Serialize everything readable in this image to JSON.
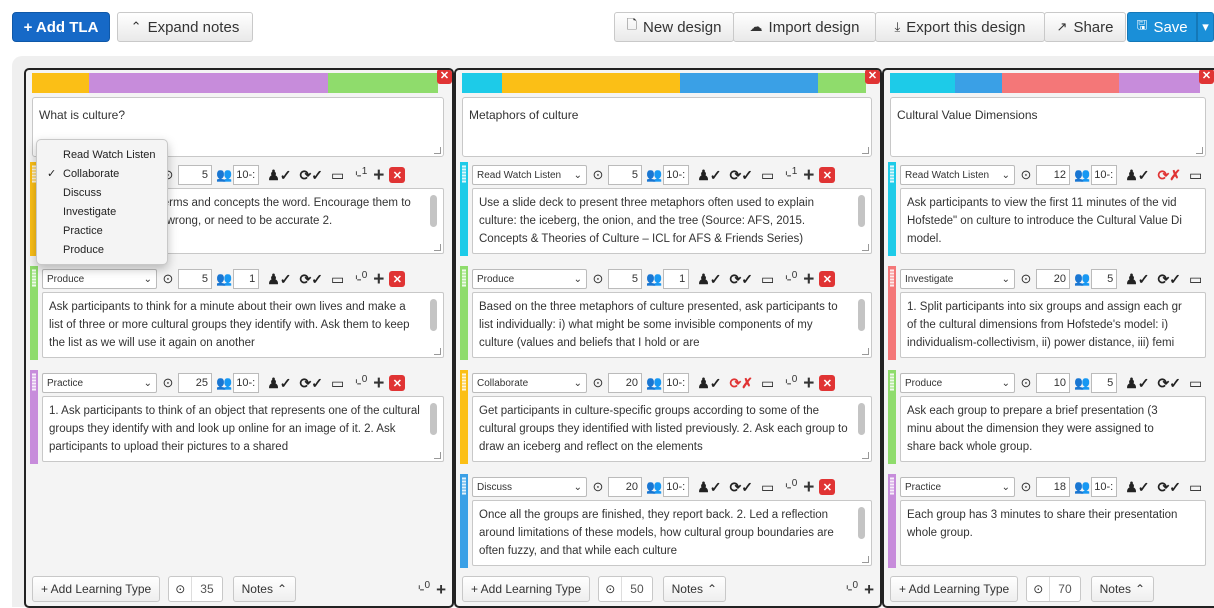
{
  "toolbar": {
    "add_tla": "+ Add TLA",
    "expand_notes": "Expand notes",
    "new_design": "New design",
    "import_design": "Import design",
    "export_design": "Export this design",
    "share": "Share",
    "save": "Save"
  },
  "menu": {
    "items": [
      "Read Watch Listen",
      "Collaborate",
      "Discuss",
      "Investigate",
      "Practice",
      "Produce"
    ],
    "checked": "Collaborate"
  },
  "designs": [
    {
      "title": "What is culture?",
      "colors": [
        "#fbbf16",
        "#c78cdb",
        "#8fdc6c"
      ],
      "tlas": [
        {
          "type": "Collaborate",
          "color": "#fbbf16",
          "duration": "5",
          "group": "10-:",
          "group_red": true,
          "assess_red": false,
          "attachments": "1",
          "text": "ask participants what terms and concepts the word. Encourage them to add as many o right or wrong, or need to be accurate 2."
        },
        {
          "type": "Produce",
          "color": "#8fdc6c",
          "duration": "5",
          "group": "1",
          "group_red": false,
          "assess_red": false,
          "attachments": "0",
          "text": "Ask participants to think for a minute about their own lives and make a list of three or more cultural groups they identify with. Ask them to keep the list as we will use it again on another"
        },
        {
          "type": "Practice",
          "color": "#c78cdb",
          "duration": "25",
          "group": "10-:",
          "group_red": true,
          "assess_red": false,
          "attachments": "0",
          "text": "1. Ask participants to think of an object that represents one of the cultural groups they identify with and look up online for an image of it. 2. Ask participants to upload their pictures to a shared"
        }
      ],
      "footer": {
        "add": "+ Add Learning Type",
        "total": "35",
        "notes": "Notes",
        "attachments": "0"
      }
    },
    {
      "title": "Metaphors of culture",
      "colors": [
        "#1dcbe8",
        "#fbbf16",
        "#3aa0e6",
        "#8fdc6c"
      ],
      "tlas": [
        {
          "type": "Read Watch Listen",
          "color": "#1dcbe8",
          "duration": "5",
          "group": "10-:",
          "group_red": true,
          "assess_red": false,
          "attachments": "1",
          "text": "Use a slide deck to present three metaphors often used to explain culture: the iceberg, the onion, and the tree (Source: AFS, 2015. Concepts & Theories of Culture – ICL for AFS & Friends Series)"
        },
        {
          "type": "Produce",
          "color": "#8fdc6c",
          "duration": "5",
          "group": "1",
          "group_red": false,
          "assess_red": false,
          "attachments": "0",
          "text": "Based on the three metaphors of culture presented, ask participants to list individually: i) what might be some invisible components of my culture (values and beliefs that I hold or are"
        },
        {
          "type": "Collaborate",
          "color": "#fbbf16",
          "duration": "20",
          "group": "10-:",
          "group_red": true,
          "assess_red": true,
          "attachments": "0",
          "text": "Get participants in culture-specific groups according to some of the cultural groups they identified with listed previously. 2. Ask each group to draw an iceberg and reflect on the elements"
        },
        {
          "type": "Discuss",
          "color": "#3aa0e6",
          "duration": "20",
          "group": "10-:",
          "group_red": true,
          "assess_red": false,
          "attachments": "0",
          "text": "Once all the groups are finished, they report back. 2. Led a reflection around limitations of these models, how cultural group boundaries are often fuzzy, and that while each culture"
        }
      ],
      "footer": {
        "add": "+ Add Learning Type",
        "total": "50",
        "notes": "Notes",
        "attachments": "0"
      }
    },
    {
      "title": "Cultural Value Dimensions",
      "colors": [
        "#1dcbe8",
        "#3aa0e6",
        "#f47778",
        "#c78cdb"
      ],
      "tlas": [
        {
          "type": "Read Watch Listen",
          "color": "#1dcbe8",
          "duration": "12",
          "group": "10-:",
          "group_red": true,
          "assess_red": true,
          "attachments": "",
          "text": "Ask participants to view the first 11 minutes of the vid Hofstede\" on culture to introduce the Cultural Value Di model."
        },
        {
          "type": "Investigate",
          "color": "#f47778",
          "duration": "20",
          "group": "5",
          "group_red": false,
          "assess_red": false,
          "attachments": "",
          "text": "1. Split participants into six groups and assign each gr of the cultural dimensions from Hofstede's model: i) individualism-collectivism, ii) power distance, iii) femi"
        },
        {
          "type": "Produce",
          "color": "#8fdc6c",
          "duration": "10",
          "group": "5",
          "group_red": false,
          "assess_red": false,
          "attachments": "",
          "text": "Ask each group to prepare a brief presentation (3 minu about the dimension they were assigned to share back whole group."
        },
        {
          "type": "Practice",
          "color": "#c78cdb",
          "duration": "18",
          "group": "10-:",
          "group_red": true,
          "assess_red": false,
          "attachments": "",
          "text": "Each group has 3 minutes to share their presentation whole group."
        }
      ],
      "footer": {
        "add": "+ Add Learning Type",
        "total": "70",
        "notes": "Notes",
        "attachments": ""
      }
    }
  ]
}
